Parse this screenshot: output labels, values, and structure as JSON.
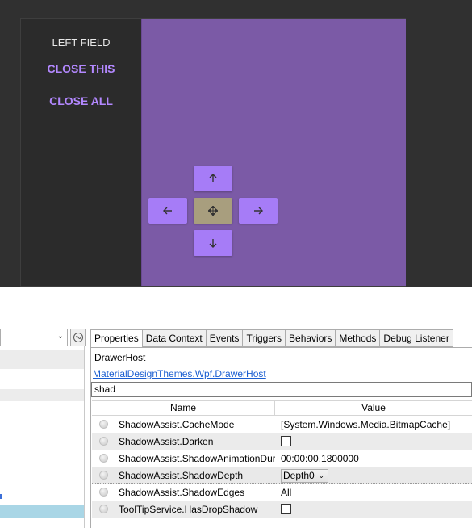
{
  "drawer": {
    "title": "LEFT FIELD",
    "close_this": "CLOSE THIS",
    "close_all": "CLOSE ALL"
  },
  "nav_buttons": [
    {
      "name": "up",
      "icon": "arrow-up-icon"
    },
    {
      "name": "left",
      "icon": "arrow-left-icon"
    },
    {
      "name": "center",
      "icon": "move-icon"
    },
    {
      "name": "right",
      "icon": "arrow-right-icon"
    },
    {
      "name": "down",
      "icon": "arrow-down-icon"
    }
  ],
  "colors": {
    "app_bg": "#303030",
    "content_bg": "#7b5aa6",
    "accent": "#b388ff",
    "button": "#a67cf7",
    "center_button": "#a89e7e",
    "link": "#1a5ed1",
    "tree_selection": "#a9d6e6"
  },
  "inspector": {
    "tabs": [
      "Properties",
      "Data Context",
      "Events",
      "Triggers",
      "Behaviors",
      "Methods",
      "Debug Listener"
    ],
    "active_tab": "Properties",
    "object_name": "DrawerHost",
    "object_type": "MaterialDesignThemes.Wpf.DrawerHost",
    "filter": "shad",
    "columns": {
      "name": "Name",
      "value": "Value"
    },
    "properties": [
      {
        "name": "ShadowAssist.CacheMode",
        "value": "[System.Windows.Media.BitmapCache]",
        "kind": "text"
      },
      {
        "name": "ShadowAssist.Darken",
        "value": "",
        "kind": "checkbox",
        "checked": false
      },
      {
        "name": "ShadowAssist.ShadowAnimationDuration",
        "value": "00:00:00.1800000",
        "kind": "text"
      },
      {
        "name": "ShadowAssist.ShadowDepth",
        "value": "Depth0",
        "kind": "select"
      },
      {
        "name": "ShadowAssist.ShadowEdges",
        "value": "All",
        "kind": "text"
      },
      {
        "name": "ToolTipService.HasDropShadow",
        "value": "",
        "kind": "checkbox",
        "checked": false
      }
    ]
  }
}
